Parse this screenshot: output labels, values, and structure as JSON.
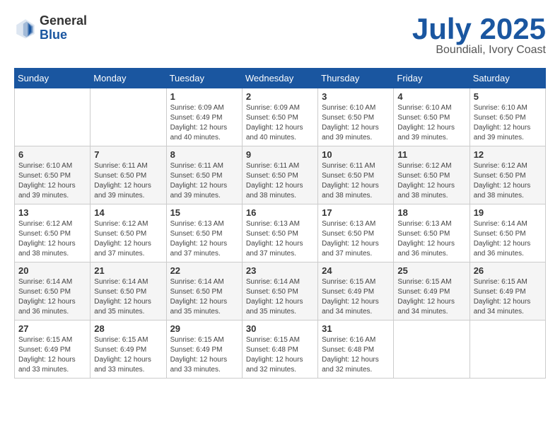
{
  "header": {
    "logo_general": "General",
    "logo_blue": "Blue",
    "month_title": "July 2025",
    "subtitle": "Boundiali, Ivory Coast"
  },
  "calendar": {
    "days_of_week": [
      "Sunday",
      "Monday",
      "Tuesday",
      "Wednesday",
      "Thursday",
      "Friday",
      "Saturday"
    ],
    "weeks": [
      [
        {
          "num": "",
          "detail": ""
        },
        {
          "num": "",
          "detail": ""
        },
        {
          "num": "1",
          "detail": "Sunrise: 6:09 AM\nSunset: 6:49 PM\nDaylight: 12 hours and 40 minutes."
        },
        {
          "num": "2",
          "detail": "Sunrise: 6:09 AM\nSunset: 6:50 PM\nDaylight: 12 hours and 40 minutes."
        },
        {
          "num": "3",
          "detail": "Sunrise: 6:10 AM\nSunset: 6:50 PM\nDaylight: 12 hours and 39 minutes."
        },
        {
          "num": "4",
          "detail": "Sunrise: 6:10 AM\nSunset: 6:50 PM\nDaylight: 12 hours and 39 minutes."
        },
        {
          "num": "5",
          "detail": "Sunrise: 6:10 AM\nSunset: 6:50 PM\nDaylight: 12 hours and 39 minutes."
        }
      ],
      [
        {
          "num": "6",
          "detail": "Sunrise: 6:10 AM\nSunset: 6:50 PM\nDaylight: 12 hours and 39 minutes."
        },
        {
          "num": "7",
          "detail": "Sunrise: 6:11 AM\nSunset: 6:50 PM\nDaylight: 12 hours and 39 minutes."
        },
        {
          "num": "8",
          "detail": "Sunrise: 6:11 AM\nSunset: 6:50 PM\nDaylight: 12 hours and 39 minutes."
        },
        {
          "num": "9",
          "detail": "Sunrise: 6:11 AM\nSunset: 6:50 PM\nDaylight: 12 hours and 38 minutes."
        },
        {
          "num": "10",
          "detail": "Sunrise: 6:11 AM\nSunset: 6:50 PM\nDaylight: 12 hours and 38 minutes."
        },
        {
          "num": "11",
          "detail": "Sunrise: 6:12 AM\nSunset: 6:50 PM\nDaylight: 12 hours and 38 minutes."
        },
        {
          "num": "12",
          "detail": "Sunrise: 6:12 AM\nSunset: 6:50 PM\nDaylight: 12 hours and 38 minutes."
        }
      ],
      [
        {
          "num": "13",
          "detail": "Sunrise: 6:12 AM\nSunset: 6:50 PM\nDaylight: 12 hours and 38 minutes."
        },
        {
          "num": "14",
          "detail": "Sunrise: 6:12 AM\nSunset: 6:50 PM\nDaylight: 12 hours and 37 minutes."
        },
        {
          "num": "15",
          "detail": "Sunrise: 6:13 AM\nSunset: 6:50 PM\nDaylight: 12 hours and 37 minutes."
        },
        {
          "num": "16",
          "detail": "Sunrise: 6:13 AM\nSunset: 6:50 PM\nDaylight: 12 hours and 37 minutes."
        },
        {
          "num": "17",
          "detail": "Sunrise: 6:13 AM\nSunset: 6:50 PM\nDaylight: 12 hours and 37 minutes."
        },
        {
          "num": "18",
          "detail": "Sunrise: 6:13 AM\nSunset: 6:50 PM\nDaylight: 12 hours and 36 minutes."
        },
        {
          "num": "19",
          "detail": "Sunrise: 6:14 AM\nSunset: 6:50 PM\nDaylight: 12 hours and 36 minutes."
        }
      ],
      [
        {
          "num": "20",
          "detail": "Sunrise: 6:14 AM\nSunset: 6:50 PM\nDaylight: 12 hours and 36 minutes."
        },
        {
          "num": "21",
          "detail": "Sunrise: 6:14 AM\nSunset: 6:50 PM\nDaylight: 12 hours and 35 minutes."
        },
        {
          "num": "22",
          "detail": "Sunrise: 6:14 AM\nSunset: 6:50 PM\nDaylight: 12 hours and 35 minutes."
        },
        {
          "num": "23",
          "detail": "Sunrise: 6:14 AM\nSunset: 6:50 PM\nDaylight: 12 hours and 35 minutes."
        },
        {
          "num": "24",
          "detail": "Sunrise: 6:15 AM\nSunset: 6:49 PM\nDaylight: 12 hours and 34 minutes."
        },
        {
          "num": "25",
          "detail": "Sunrise: 6:15 AM\nSunset: 6:49 PM\nDaylight: 12 hours and 34 minutes."
        },
        {
          "num": "26",
          "detail": "Sunrise: 6:15 AM\nSunset: 6:49 PM\nDaylight: 12 hours and 34 minutes."
        }
      ],
      [
        {
          "num": "27",
          "detail": "Sunrise: 6:15 AM\nSunset: 6:49 PM\nDaylight: 12 hours and 33 minutes."
        },
        {
          "num": "28",
          "detail": "Sunrise: 6:15 AM\nSunset: 6:49 PM\nDaylight: 12 hours and 33 minutes."
        },
        {
          "num": "29",
          "detail": "Sunrise: 6:15 AM\nSunset: 6:49 PM\nDaylight: 12 hours and 33 minutes."
        },
        {
          "num": "30",
          "detail": "Sunrise: 6:15 AM\nSunset: 6:48 PM\nDaylight: 12 hours and 32 minutes."
        },
        {
          "num": "31",
          "detail": "Sunrise: 6:16 AM\nSunset: 6:48 PM\nDaylight: 12 hours and 32 minutes."
        },
        {
          "num": "",
          "detail": ""
        },
        {
          "num": "",
          "detail": ""
        }
      ]
    ]
  }
}
